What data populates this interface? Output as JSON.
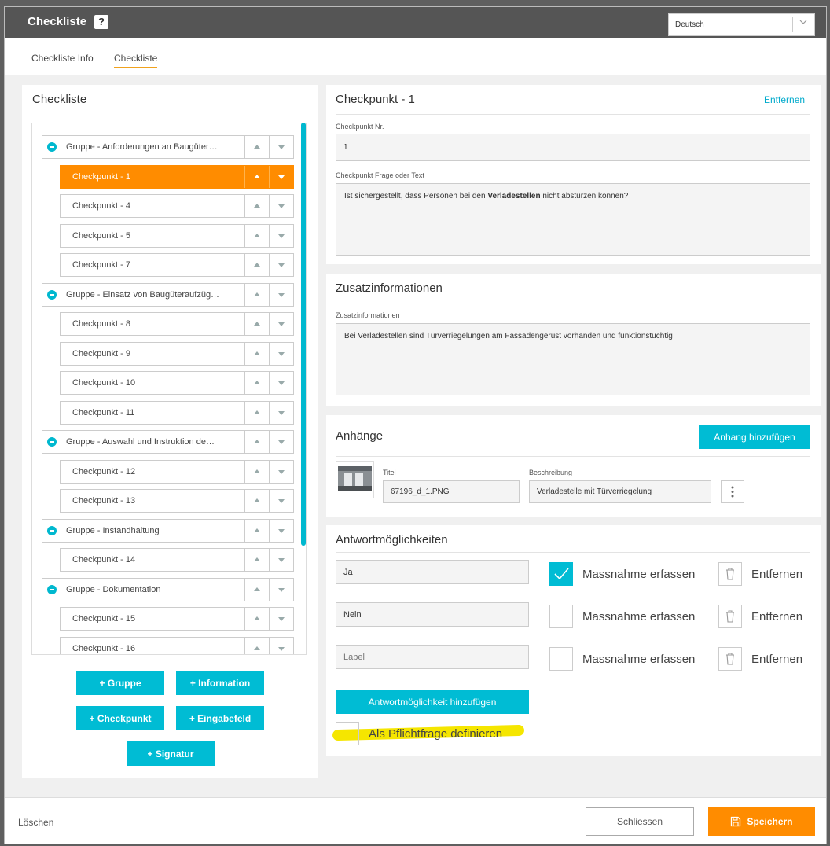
{
  "header": {
    "title": "Checkliste",
    "help": "?",
    "language": "Deutsch"
  },
  "tabs": [
    {
      "label": "Checkliste Info"
    },
    {
      "label": "Checkliste"
    }
  ],
  "left": {
    "title": "Checkliste",
    "tree": [
      {
        "label": "Gruppe - Anforderungen an Baugüter…",
        "type": "group"
      },
      {
        "label": "Checkpunkt - 1",
        "type": "item",
        "active": true
      },
      {
        "label": "Checkpunkt - 4",
        "type": "item"
      },
      {
        "label": "Checkpunkt - 5",
        "type": "item"
      },
      {
        "label": "Checkpunkt - 7",
        "type": "item"
      },
      {
        "label": "Gruppe - Einsatz von Baugüteraufzüg…",
        "type": "group"
      },
      {
        "label": "Checkpunkt - 8",
        "type": "item"
      },
      {
        "label": "Checkpunkt - 9",
        "type": "item"
      },
      {
        "label": "Checkpunkt - 10",
        "type": "item"
      },
      {
        "label": "Checkpunkt - 11",
        "type": "item"
      },
      {
        "label": "Gruppe - Auswahl und Instruktion de…",
        "type": "group"
      },
      {
        "label": "Checkpunkt - 12",
        "type": "item"
      },
      {
        "label": "Checkpunkt - 13",
        "type": "item"
      },
      {
        "label": "Gruppe - Instandhaltung",
        "type": "group"
      },
      {
        "label": "Checkpunkt - 14",
        "type": "item"
      },
      {
        "label": "Gruppe - Dokumentation",
        "type": "group"
      },
      {
        "label": "Checkpunkt - 15",
        "type": "item"
      },
      {
        "label": "Checkpunkt - 16",
        "type": "item"
      }
    ],
    "buttons": {
      "gruppe": "+ Gruppe",
      "information": "+ Information",
      "checkpunkt": "+ Checkpunkt",
      "eingabefeld": "+ Eingabefeld",
      "signatur": "+ Signatur"
    }
  },
  "checkpoint": {
    "title": "Checkpunkt - 1",
    "remove": "Entfernen",
    "nr_label": "Checkpunkt Nr.",
    "nr_value": "1",
    "question_label": "Checkpunkt Frage oder Text",
    "question_pre": "Ist sichergestellt, dass Personen bei den ",
    "question_bold": "Verladestellen",
    "question_post": " nicht abstürzen können?"
  },
  "extra": {
    "title": "Zusatzinformationen",
    "label": "Zusatzinformationen",
    "value": "Bei Verladestellen sind Türverriegelungen am Fassadengerüst vorhanden und funktionstüchtig"
  },
  "attachments": {
    "title": "Anhänge",
    "add_button": "Anhang hinzufügen",
    "col_title": "Titel",
    "col_desc": "Beschreibung",
    "item_title": "67196_d_1.PNG",
    "item_desc": "Verladestelle mit Türverriegelung"
  },
  "answers": {
    "title": "Antwortmöglichkeiten",
    "options": [
      {
        "value": "Ja",
        "placeholder": "",
        "checked": true
      },
      {
        "value": "Nein",
        "placeholder": "",
        "checked": false
      },
      {
        "value": "",
        "placeholder": "Label",
        "checked": false
      }
    ],
    "measure_label": "Massnahme erfassen",
    "remove_label": "Entfernen",
    "add_button": "Antwortmöglichkeit hinzufügen",
    "mandatory_label": "Als Pflichtfrage definieren",
    "highlight_color": "#f5e600"
  },
  "footer": {
    "delete": "Löschen",
    "close": "Schliessen",
    "save": "Speichern"
  }
}
